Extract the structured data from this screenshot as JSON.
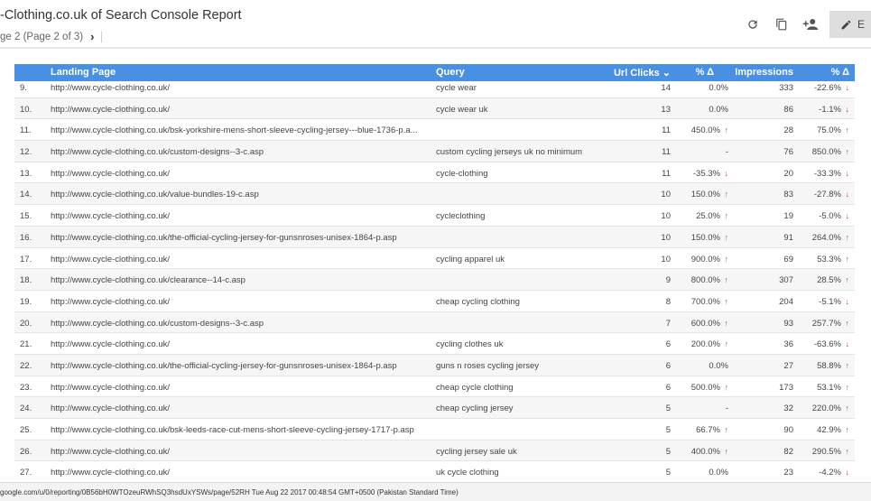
{
  "header": {
    "title": "-Clothing.co.uk of Search Console Report",
    "page_label": "ge 2 (Page 2 of 3)",
    "next_icon": "chevron-right-icon"
  },
  "toolbar": {
    "refresh_icon": "refresh-icon",
    "copy_icon": "copy-icon",
    "share_icon": "person-add-icon",
    "edit_icon": "pencil-icon",
    "edit_label": "E"
  },
  "table": {
    "columns": {
      "landing": "Landing Page",
      "query": "Query",
      "clicks": "Url Clicks ⌄",
      "delta1": "% Δ",
      "impressions": "Impressions",
      "delta2": "% Δ"
    },
    "rows": [
      {
        "num": "9.",
        "landing": "http://www.cycle-clothing.co.uk/",
        "query": "cycle wear",
        "clicks": "14",
        "d1": "0.0%",
        "d1dir": "",
        "impr": "333",
        "d2": "-22.6%",
        "d2dir": "down"
      },
      {
        "num": "10.",
        "landing": "http://www.cycle-clothing.co.uk/",
        "query": "cycle wear uk",
        "clicks": "13",
        "d1": "0.0%",
        "d1dir": "",
        "impr": "86",
        "d2": "-1.1%",
        "d2dir": "down"
      },
      {
        "num": "11.",
        "landing": "http://www.cycle-clothing.co.uk/bsk-yorkshire-mens-short-sleeve-cycling-jersey---blue-1736-p.a...",
        "query": "",
        "clicks": "11",
        "d1": "450.0%",
        "d1dir": "up",
        "impr": "28",
        "d2": "75.0%",
        "d2dir": "up"
      },
      {
        "num": "12.",
        "landing": "http://www.cycle-clothing.co.uk/custom-designs--3-c.asp",
        "query": "custom cycling jerseys uk no minimum",
        "clicks": "11",
        "d1": "-",
        "d1dir": "",
        "impr": "76",
        "d2": "850.0%",
        "d2dir": "up"
      },
      {
        "num": "13.",
        "landing": "http://www.cycle-clothing.co.uk/",
        "query": "cycle-clothing",
        "clicks": "11",
        "d1": "-35.3%",
        "d1dir": "down",
        "impr": "20",
        "d2": "-33.3%",
        "d2dir": "down"
      },
      {
        "num": "14.",
        "landing": "http://www.cycle-clothing.co.uk/value-bundles-19-c.asp",
        "query": "",
        "clicks": "10",
        "d1": "150.0%",
        "d1dir": "up",
        "impr": "83",
        "d2": "-27.8%",
        "d2dir": "down"
      },
      {
        "num": "15.",
        "landing": "http://www.cycle-clothing.co.uk/",
        "query": "cycleclothing",
        "clicks": "10",
        "d1": "25.0%",
        "d1dir": "up",
        "impr": "19",
        "d2": "-5.0%",
        "d2dir": "down"
      },
      {
        "num": "16.",
        "landing": "http://www.cycle-clothing.co.uk/the-official-cycling-jersey-for-gunsnroses-unisex-1864-p.asp",
        "query": "",
        "clicks": "10",
        "d1": "150.0%",
        "d1dir": "up",
        "impr": "91",
        "d2": "264.0%",
        "d2dir": "up"
      },
      {
        "num": "17.",
        "landing": "http://www.cycle-clothing.co.uk/",
        "query": "cycling apparel uk",
        "clicks": "10",
        "d1": "900.0%",
        "d1dir": "up",
        "impr": "69",
        "d2": "53.3%",
        "d2dir": "up"
      },
      {
        "num": "18.",
        "landing": "http://www.cycle-clothing.co.uk/clearance--14-c.asp",
        "query": "",
        "clicks": "9",
        "d1": "800.0%",
        "d1dir": "up",
        "impr": "307",
        "d2": "28.5%",
        "d2dir": "up"
      },
      {
        "num": "19.",
        "landing": "http://www.cycle-clothing.co.uk/",
        "query": "cheap cycling clothing",
        "clicks": "8",
        "d1": "700.0%",
        "d1dir": "up",
        "impr": "204",
        "d2": "-5.1%",
        "d2dir": "down"
      },
      {
        "num": "20.",
        "landing": "http://www.cycle-clothing.co.uk/custom-designs--3-c.asp",
        "query": "",
        "clicks": "7",
        "d1": "600.0%",
        "d1dir": "up",
        "impr": "93",
        "d2": "257.7%",
        "d2dir": "up"
      },
      {
        "num": "21.",
        "landing": "http://www.cycle-clothing.co.uk/",
        "query": "cycling clothes uk",
        "clicks": "6",
        "d1": "200.0%",
        "d1dir": "up",
        "impr": "36",
        "d2": "-63.6%",
        "d2dir": "down"
      },
      {
        "num": "22.",
        "landing": "http://www.cycle-clothing.co.uk/the-official-cycling-jersey-for-gunsnroses-unisex-1864-p.asp",
        "query": "guns n roses cycling jersey",
        "clicks": "6",
        "d1": "0.0%",
        "d1dir": "",
        "impr": "27",
        "d2": "58.8%",
        "d2dir": "up"
      },
      {
        "num": "23.",
        "landing": "http://www.cycle-clothing.co.uk/",
        "query": "cheap cycle clothing",
        "clicks": "6",
        "d1": "500.0%",
        "d1dir": "up",
        "impr": "173",
        "d2": "53.1%",
        "d2dir": "up"
      },
      {
        "num": "24.",
        "landing": "http://www.cycle-clothing.co.uk/",
        "query": "cheap cycling jersey",
        "clicks": "5",
        "d1": "-",
        "d1dir": "",
        "impr": "32",
        "d2": "220.0%",
        "d2dir": "up"
      },
      {
        "num": "25.",
        "landing": "http://www.cycle-clothing.co.uk/bsk-leeds-race-cut-mens-short-sleeve-cycling-jersey-1717-p.asp",
        "query": "",
        "clicks": "5",
        "d1": "66.7%",
        "d1dir": "up",
        "impr": "90",
        "d2": "42.9%",
        "d2dir": "up"
      },
      {
        "num": "26.",
        "landing": "http://www.cycle-clothing.co.uk/",
        "query": "cycling jersey sale uk",
        "clicks": "5",
        "d1": "400.0%",
        "d1dir": "up",
        "impr": "82",
        "d2": "290.5%",
        "d2dir": "up"
      },
      {
        "num": "27.",
        "landing": "http://www.cycle-clothing.co.uk/",
        "query": "uk cycle clothing",
        "clicks": "5",
        "d1": "0.0%",
        "d1dir": "",
        "impr": "23",
        "d2": "-4.2%",
        "d2dir": "down"
      }
    ]
  },
  "footer": {
    "text": "google.com/u/0/reporting/0B56bH0WTOzeuRWhSQ3hsdUxYSWs/page/52RH Tue Aug 22 2017 00:48:54 GMT+0500 (Pakistan Standard Time)"
  },
  "colors": {
    "header_blue": "#4a90e2",
    "up_green": "#2e9b3a",
    "down_red": "#e53935"
  }
}
